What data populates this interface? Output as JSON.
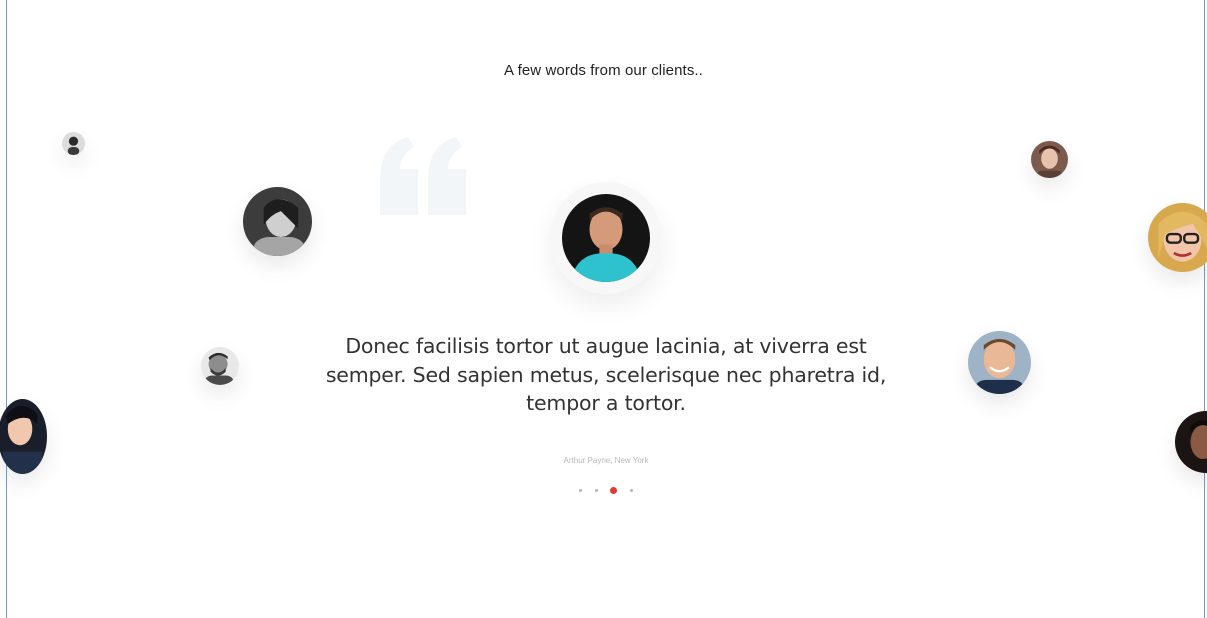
{
  "section": {
    "heading": "A few words from our clients.."
  },
  "testimonial": {
    "quote": "Donec facilisis tortor ut augue lacinia, at viverra est semper. Sed sapien metus, scelerisque nec pharetra id, tempor a tortor.",
    "author": "Arthur Payne, New York",
    "quote_icon": "quote-mark-icon"
  },
  "slider": {
    "dot_count": 4,
    "active_index": 2
  },
  "colors": {
    "accent": "#e53935",
    "quote_mark": "#f3f6f9",
    "frame_border": "#6f9fd6"
  }
}
